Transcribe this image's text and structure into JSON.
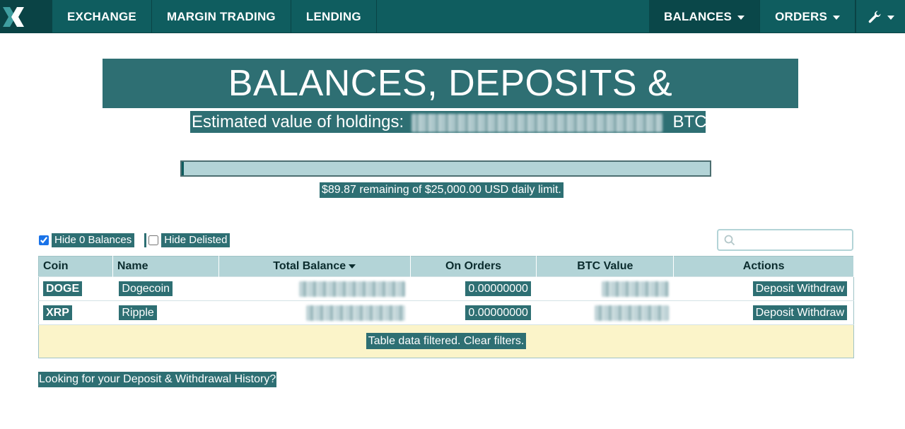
{
  "nav": {
    "left": [
      {
        "label": "EXCHANGE"
      },
      {
        "label": "MARGIN TRADING"
      },
      {
        "label": "LENDING"
      }
    ],
    "balances_label": "BALANCES",
    "orders_label": "ORDERS"
  },
  "page": {
    "title": "BALANCES, DEPOSITS & WITHDRAWALS",
    "estimate_label": "Estimated value of holdings:",
    "estimate_unit": "BTC",
    "daily_limit_text": "$89.87 remaining of $25,000.00 USD daily limit.",
    "daily_limit_used_fraction": 0.0036
  },
  "filters": {
    "hide_zero_label": "Hide 0 Balances",
    "hide_zero_checked": true,
    "hide_delisted_label": "Hide Delisted",
    "hide_delisted_checked": false,
    "search_placeholder": ""
  },
  "table": {
    "headers": [
      "Coin",
      "Name",
      "Total Balance",
      "On Orders",
      "BTC Value",
      "Actions"
    ],
    "rows": [
      {
        "coin": "DOGE",
        "name": "Dogecoin",
        "on_orders": "0.00000000",
        "deposit": "Deposit",
        "withdraw": "Withdraw"
      },
      {
        "coin": "XRP",
        "name": "Ripple",
        "on_orders": "0.00000000",
        "deposit": "Deposit",
        "withdraw": "Withdraw"
      }
    ],
    "filtered_notice": "Table data filtered. Clear filters."
  },
  "history_link": "Looking for your Deposit & Withdrawal History?",
  "colors": {
    "nav_bg": "#0f5d5f",
    "highlight": "#2e6f73",
    "table_header": "#b3d4d7",
    "filtered_row": "#fbf4c9"
  }
}
